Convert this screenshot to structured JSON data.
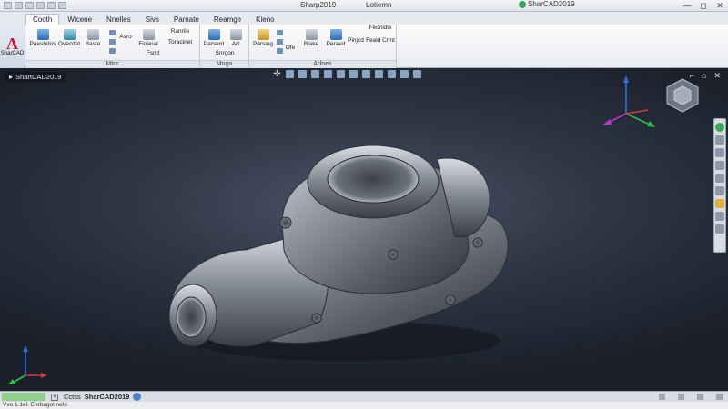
{
  "titlebar": {
    "app_title": "Sharp2019",
    "doc_title": "Lotiemn",
    "cloud_title": "SharCAD2019",
    "controls": [
      "—",
      "◻",
      "✕"
    ]
  },
  "ribbon": {
    "tabs": [
      "Cooth",
      "Wicene",
      "Nnelles",
      "Sivs",
      "Parnate",
      "Reamge",
      "Kieno"
    ],
    "app_button_label": "SharCAD",
    "panels": [
      {
        "title": "Mtrir",
        "tools": [
          "Paeshdos",
          "Ovecdet",
          "Baste",
          "Asro",
          "Floanal",
          "Ranrile",
          "Toracinet",
          "Fsnd"
        ]
      },
      {
        "title": "Mnga",
        "tools": [
          "Parsent",
          "Art",
          "Snrgon"
        ]
      },
      {
        "title": "Arfoes",
        "tools": [
          "Parsing",
          "Ofe",
          "Blake",
          "Peraed",
          "Pinjcd",
          "Feonidle",
          "Feald Crint"
        ]
      }
    ]
  },
  "viewport": {
    "label": "ShartCAD2019",
    "controls": [
      "⌐",
      "⌂",
      "✕"
    ],
    "axis_colors": {
      "z": "#2f6fd6",
      "y": "#2fbf4a",
      "x": "#d23b3b",
      "w": "#b03ad0"
    }
  },
  "statusbar": {
    "close_label": "",
    "tab_label": "Cctss",
    "main_label": "SharCAD2019"
  },
  "footer": {
    "text": "Vvo 1.1el.  Enrbagol nets"
  }
}
